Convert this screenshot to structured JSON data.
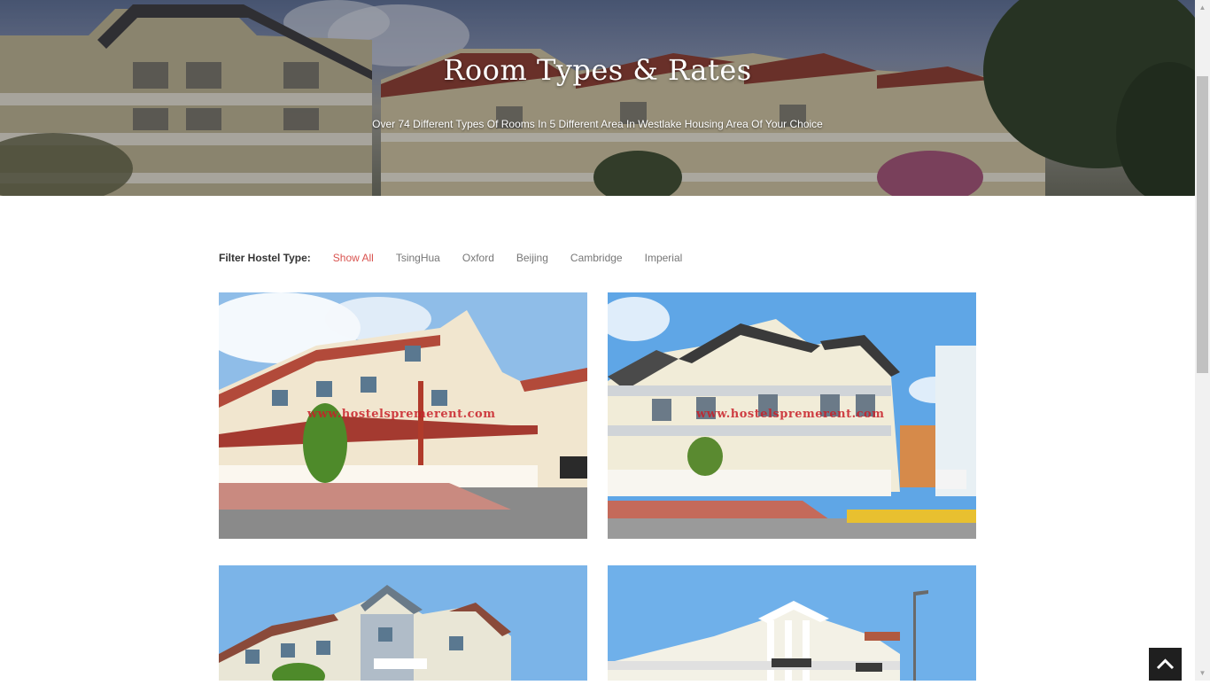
{
  "hero": {
    "title": "Room Types & Rates",
    "subtitle": "Over 74 Different Types Of Rooms In 5 Different Area In Westlake Housing Area Of Your Choice"
  },
  "filter": {
    "label": "Filter Hostel Type:",
    "options": [
      "Show All",
      "TsingHua",
      "Oxford",
      "Beijing",
      "Cambridge",
      "Imperial"
    ],
    "active": "Show All"
  },
  "gallery": [
    {
      "watermark": "www.hostelspremerent.com"
    },
    {
      "watermark": "www.hostelspremerent.com"
    }
  ],
  "back_to_top_icon": "chevron-up-icon",
  "colors": {
    "accent": "#d9534f",
    "filter_text": "#777777",
    "label": "#333333"
  }
}
